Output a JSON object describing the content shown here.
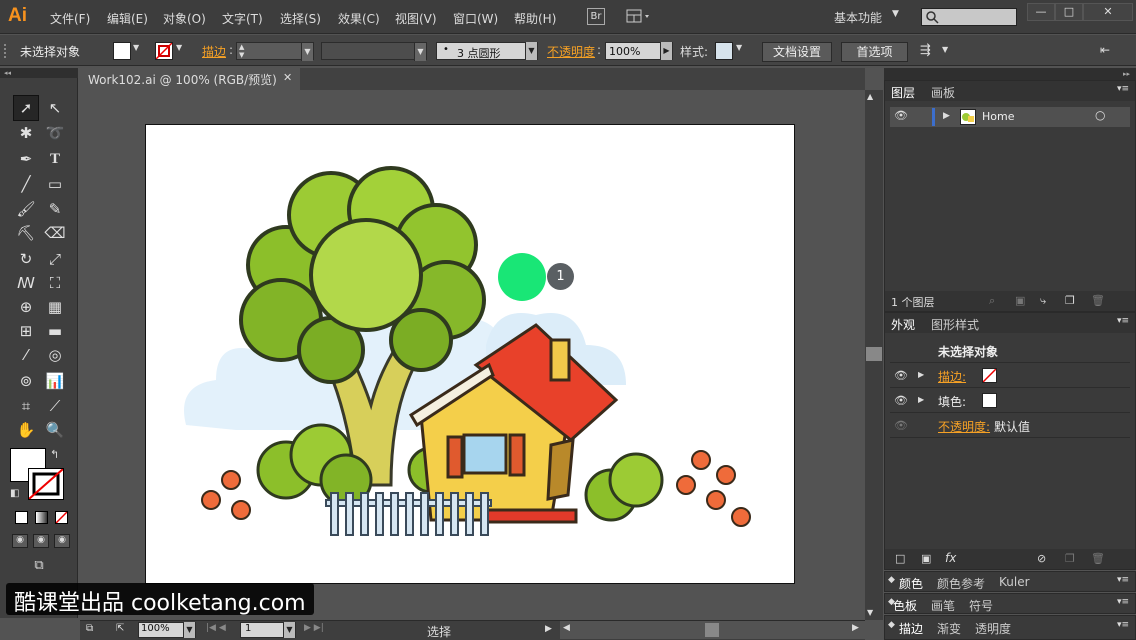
{
  "app": {
    "logo": "Ai"
  },
  "menu": [
    "文件(F)",
    "编辑(E)",
    "对象(O)",
    "文字(T)",
    "选择(S)",
    "效果(C)",
    "视图(V)",
    "窗口(W)",
    "帮助(H)"
  ],
  "bridge_label": "Br",
  "workspace": "基本功能",
  "control": {
    "selection_label": "未选择对象",
    "stroke_label": "描边",
    "brush_value": "3 点圆形",
    "opacity_label": "不透明度",
    "opacity_value": "100%",
    "style_label": "样式:",
    "doc_setup": "文档设置",
    "prefs": "首选项"
  },
  "document": {
    "tab": "Work102.ai @ 100% (RGB/预览)"
  },
  "annotation": {
    "number": "1"
  },
  "status": {
    "zoom": "100%",
    "page": "1",
    "tool": "选择"
  },
  "layers": {
    "tabs": [
      "图层",
      "画板"
    ],
    "items": [
      {
        "name": "Home"
      }
    ],
    "count": "1 个图层"
  },
  "appearance": {
    "tabs": [
      "外观",
      "图形样式"
    ],
    "title": "未选择对象",
    "stroke_label": "描边:",
    "fill_label": "填色:",
    "opacity_label": "不透明度:",
    "opacity_value": "默认值"
  },
  "collapsed_panels": [
    [
      "颜色",
      "颜色参考",
      "Kuler"
    ],
    [
      "色板",
      "画笔",
      "符号"
    ],
    [
      "描边",
      "渐变",
      "透明度"
    ]
  ],
  "watermark": "酷课堂出品 coolketang.com",
  "colors": {
    "accent": "#f6a125",
    "marker": "#19e676",
    "layer_bar": "#3c6ecc"
  }
}
